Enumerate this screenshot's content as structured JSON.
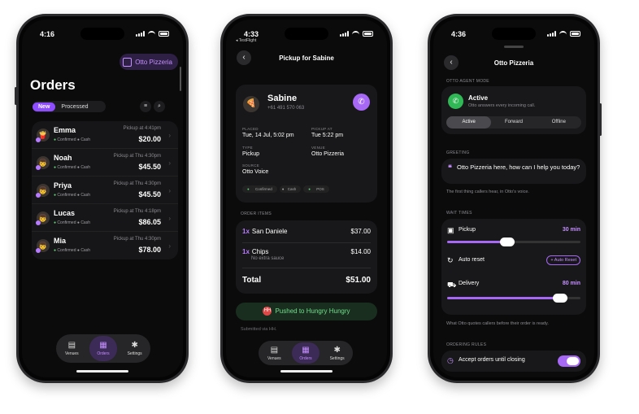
{
  "phone1": {
    "status_time": "4:16",
    "venue_pill": "Otto Pizzeria",
    "title": "Orders",
    "tabs": {
      "new": "New",
      "processed": "Processed"
    },
    "orders": [
      {
        "name": "Emma",
        "tags": [
          "Confirmed",
          "Cash"
        ],
        "pickup": "Pickup at 4:41pm",
        "amount": "$20.00",
        "avatar": "🍟"
      },
      {
        "name": "Noah",
        "tags": [
          "Confirmed",
          "Cash"
        ],
        "pickup": "Pickup at Thu 4:30pm",
        "amount": "$45.50",
        "avatar": "👦"
      },
      {
        "name": "Priya",
        "tags": [
          "Confirmed",
          "Cash"
        ],
        "pickup": "Pickup at Thu 4:30pm",
        "amount": "$45.50",
        "avatar": "👦"
      },
      {
        "name": "Lucas",
        "tags": [
          "Confirmed",
          "Cash"
        ],
        "pickup": "Pickup at Thu 4:18pm",
        "amount": "$86.05",
        "avatar": "👦"
      },
      {
        "name": "Mia",
        "tags": [
          "Confirmed",
          "Cash"
        ],
        "pickup": "Pickup at Thu 4:30pm",
        "amount": "$78.00",
        "avatar": "👦"
      }
    ],
    "tabbar": [
      {
        "label": "Venues",
        "icon": "store-icon"
      },
      {
        "label": "Orders",
        "icon": "receipt-icon"
      },
      {
        "label": "Settings",
        "icon": "gear-icon"
      }
    ]
  },
  "phone2": {
    "status_time": "4:33",
    "testflight": "◂ TestFlight",
    "header": "Pickup for Sabine",
    "customer": {
      "name": "Sabine",
      "phone": "+61 491 570 063"
    },
    "placed_label": "PLACED",
    "placed": "Tue, 14 Jul, 5:02 pm",
    "pickup_label": "PICKUP AT",
    "pickup": "Tue 5:22 pm",
    "type_label": "TYPE",
    "type": "Pickup",
    "venue_label": "VENUE",
    "venue": "Otto Pizzeria",
    "source_label": "SOURCE",
    "source": "Otto Voice",
    "tags": [
      "Confirmed",
      "Cash",
      "POS"
    ],
    "items_label": "ORDER ITEMS",
    "items": [
      {
        "qty": "1x",
        "name": "San Daniele",
        "price": "$37.00",
        "note": ""
      },
      {
        "qty": "1x",
        "name": "Chips",
        "price": "$14.00",
        "note": "No extra sauce"
      }
    ],
    "total_label": "Total",
    "total": "$51.00",
    "pushed": "Pushed to Hungry Hungry",
    "pushed_badge": "HH",
    "submitted": "Submitted via HH.",
    "tabbar": [
      {
        "label": "Venues"
      },
      {
        "label": "Orders"
      },
      {
        "label": "Settings"
      }
    ]
  },
  "phone3": {
    "status_time": "4:36",
    "header": "Otto Pizzeria",
    "agent_mode_label": "OTTO AGENT MODE",
    "agent_status": "Active",
    "agent_desc": "Otto answers every incoming call.",
    "modes": [
      "Active",
      "Forward",
      "Offline"
    ],
    "greeting_label": "GREETING",
    "greeting": "Otto Pizzeria here, how can I help you today?",
    "greeting_note": "The first thing callers hear, in Otto's voice.",
    "wait_label": "WAIT TIMES",
    "pickup_label": "Pickup",
    "pickup_val": "30 min",
    "pickup_level": 0.45,
    "autoreset_label": "Auto reset",
    "autoreset_btn": "+ Auto Reset",
    "delivery_label": "Delivery",
    "delivery_val": "80 min",
    "delivery_level": 0.85,
    "wait_note": "What Otto quotes callers before their order is ready.",
    "rules_label": "ORDERING RULES",
    "accept_label": "Accept orders until closing",
    "accept_on": true
  }
}
